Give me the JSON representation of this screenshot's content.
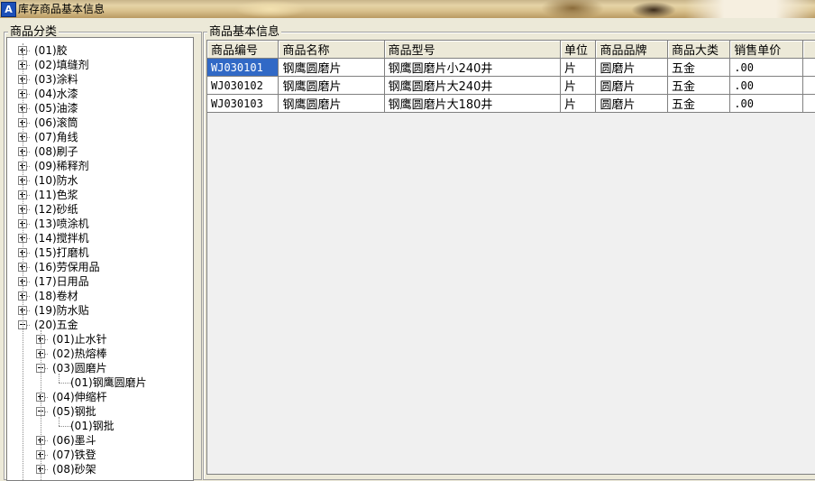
{
  "window": {
    "title": "库存商品基本信息",
    "app_icon": "A"
  },
  "left_panel": {
    "legend": "商品分类",
    "tree": [
      {
        "label": "(01)胶",
        "level": 0,
        "toggle": "plus"
      },
      {
        "label": "(02)填缝剂",
        "level": 0,
        "toggle": "plus"
      },
      {
        "label": "(03)涂料",
        "level": 0,
        "toggle": "plus"
      },
      {
        "label": "(04)水漆",
        "level": 0,
        "toggle": "plus"
      },
      {
        "label": "(05)油漆",
        "level": 0,
        "toggle": "plus"
      },
      {
        "label": "(06)滚筒",
        "level": 0,
        "toggle": "plus"
      },
      {
        "label": "(07)角线",
        "level": 0,
        "toggle": "plus"
      },
      {
        "label": "(08)刷子",
        "level": 0,
        "toggle": "plus"
      },
      {
        "label": "(09)稀释剂",
        "level": 0,
        "toggle": "plus"
      },
      {
        "label": "(10)防水",
        "level": 0,
        "toggle": "plus"
      },
      {
        "label": "(11)色浆",
        "level": 0,
        "toggle": "plus"
      },
      {
        "label": "(12)砂纸",
        "level": 0,
        "toggle": "plus"
      },
      {
        "label": "(13)喷涂机",
        "level": 0,
        "toggle": "plus"
      },
      {
        "label": "(14)搅拌机",
        "level": 0,
        "toggle": "plus"
      },
      {
        "label": "(15)打磨机",
        "level": 0,
        "toggle": "plus"
      },
      {
        "label": "(16)劳保用品",
        "level": 0,
        "toggle": "plus"
      },
      {
        "label": "(17)日用品",
        "level": 0,
        "toggle": "plus"
      },
      {
        "label": "(18)卷材",
        "level": 0,
        "toggle": "plus"
      },
      {
        "label": "(19)防水贴",
        "level": 0,
        "toggle": "plus"
      },
      {
        "label": "(20)五金",
        "level": 0,
        "toggle": "minus"
      },
      {
        "label": "(01)止水针",
        "level": 1,
        "toggle": "plus"
      },
      {
        "label": "(02)热熔棒",
        "level": 1,
        "toggle": "plus"
      },
      {
        "label": "(03)圆磨片",
        "level": 1,
        "toggle": "minus"
      },
      {
        "label": "(01)钢鹰圆磨片",
        "level": 2,
        "toggle": "none"
      },
      {
        "label": "(04)伸缩杆",
        "level": 1,
        "toggle": "plus"
      },
      {
        "label": "(05)钢批",
        "level": 1,
        "toggle": "minus"
      },
      {
        "label": "(01)钢批",
        "level": 2,
        "toggle": "none"
      },
      {
        "label": "(06)墨斗",
        "level": 1,
        "toggle": "plus"
      },
      {
        "label": "(07)铁登",
        "level": 1,
        "toggle": "plus"
      },
      {
        "label": "(08)砂架",
        "level": 1,
        "toggle": "plus"
      }
    ]
  },
  "right_panel": {
    "legend": "商品基本信息",
    "columns": [
      "商品编号",
      "商品名称",
      "商品型号",
      "单位",
      "商品品牌",
      "商品大类",
      "销售单价"
    ],
    "rows": [
      [
        "WJ030101",
        "钢鹰圆磨片",
        "钢鹰圆磨片小240井",
        "片",
        "圆磨片",
        "五金",
        ".00"
      ],
      [
        "WJ030102",
        "钢鹰圆磨片",
        "钢鹰圆磨片大240井",
        "片",
        "圆磨片",
        "五金",
        ".00"
      ],
      [
        "WJ030103",
        "钢鹰圆磨片",
        "钢鹰圆磨片大180井",
        "片",
        "圆磨片",
        "五金",
        ".00"
      ]
    ]
  },
  "colors": {
    "selection": "#3169c6",
    "window_bg": "#ece9d8"
  }
}
